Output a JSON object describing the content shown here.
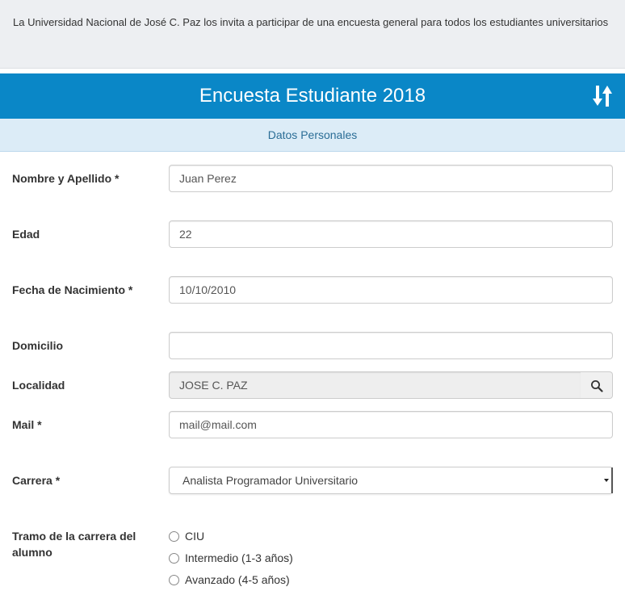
{
  "intro": {
    "text": "La Universidad Nacional de José C. Paz los  invita a participar de una encuesta general para todos los estudiantes universitarios"
  },
  "header": {
    "title": "Encuesta Estudiante 2018",
    "toggle_icon": "sort-arrows-icon"
  },
  "section": {
    "title": "Datos Personales"
  },
  "form": {
    "nombre": {
      "label": "Nombre y Apellido *",
      "value": "Juan Perez"
    },
    "edad": {
      "label": "Edad",
      "value": "22"
    },
    "fecha": {
      "label": "Fecha de Nacimiento *",
      "value": "10/10/2010"
    },
    "domicilio": {
      "label": "Domicilio",
      "value": ""
    },
    "localidad": {
      "label": "Localidad",
      "value": "JOSE C. PAZ",
      "button_icon": "search-icon"
    },
    "mail": {
      "label": "Mail *",
      "value": "mail@mail.com"
    },
    "carrera": {
      "label": "Carrera *",
      "selected": "Analista Programador Universitario"
    },
    "tramo": {
      "label_line1": "Tramo de la carrera del",
      "label_line2": "alumno",
      "options": [
        "CIU",
        "Intermedio (1-3 años)",
        "Avanzado (4-5 años)"
      ]
    }
  },
  "colors": {
    "header_bg": "#0a87c7",
    "section_bg": "#dcecf7",
    "section_text": "#2a6d96",
    "intro_bg": "#edeff2"
  }
}
